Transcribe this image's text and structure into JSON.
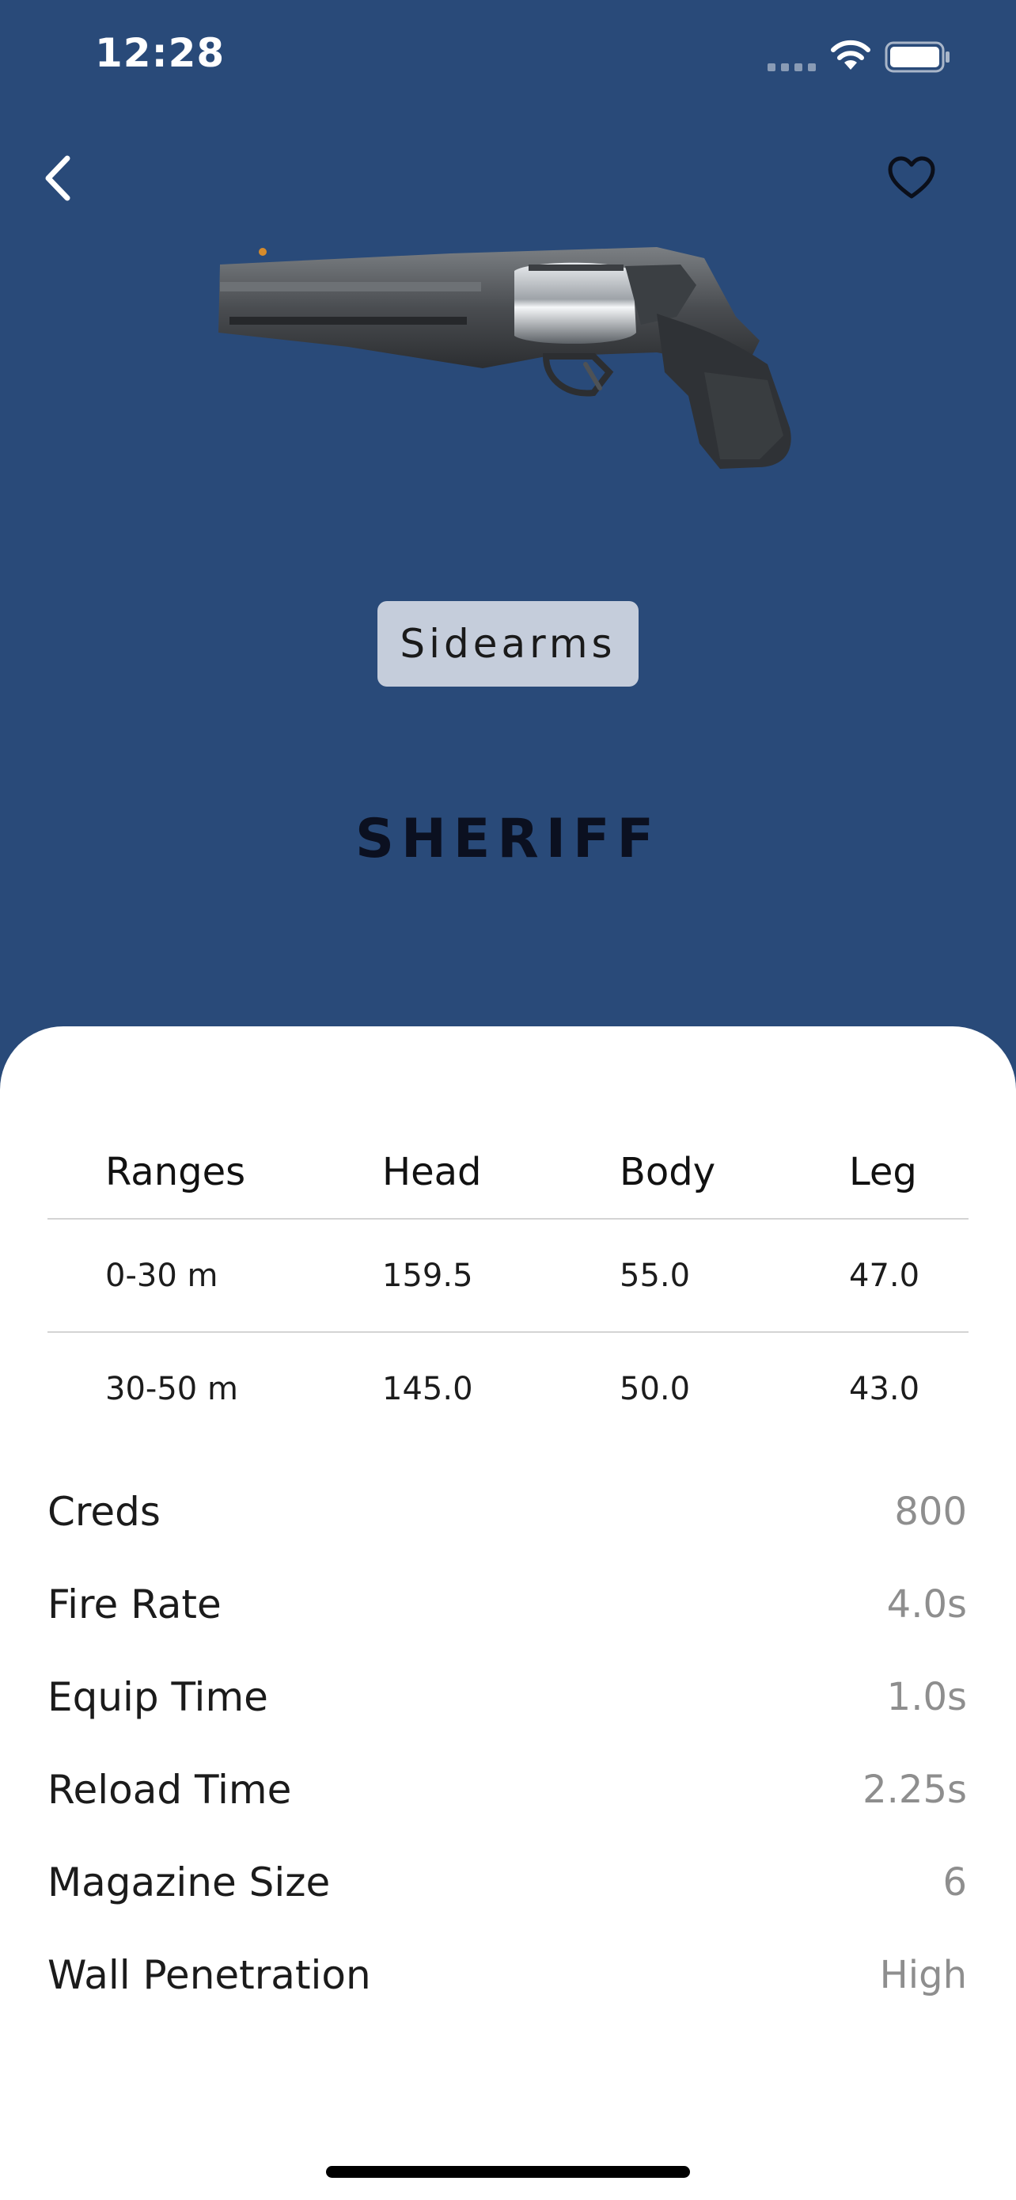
{
  "status_bar": {
    "time": "12:28"
  },
  "nav": {
    "back_icon": "chevron-left-icon",
    "favorite_icon": "heart-outline-icon"
  },
  "weapon": {
    "category": "Sidearms",
    "name": "SHERIFF"
  },
  "damage_table": {
    "headers": [
      "Ranges",
      "Head",
      "Body",
      "Leg"
    ],
    "rows": [
      [
        "0-30 m",
        "159.5",
        "55.0",
        "47.0"
      ],
      [
        "30-50 m",
        "145.0",
        "50.0",
        "43.0"
      ]
    ]
  },
  "stats": [
    {
      "label": "Creds",
      "value": "800"
    },
    {
      "label": "Fire Rate",
      "value": "4.0s"
    },
    {
      "label": "Equip Time",
      "value": "1.0s"
    },
    {
      "label": "Reload Time",
      "value": "2.25s"
    },
    {
      "label": "Magazine Size",
      "value": "6"
    },
    {
      "label": "Wall Penetration",
      "value": "High"
    }
  ],
  "colors": {
    "hero_bg": "#294a79",
    "chip_bg": "#c5cddb",
    "value_gray": "#8e8e8e"
  }
}
